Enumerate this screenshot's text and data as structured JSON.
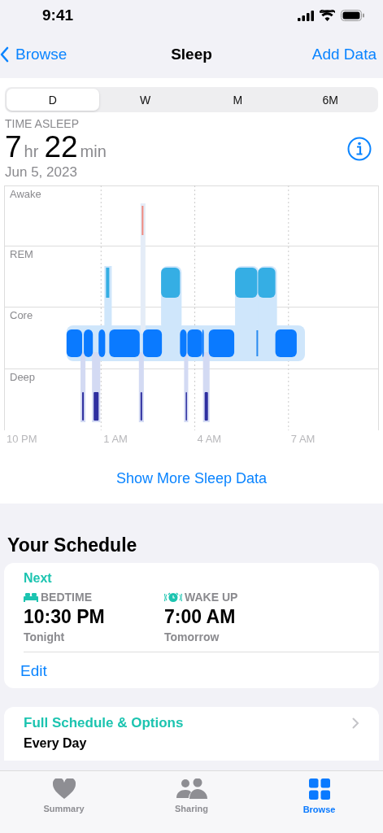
{
  "status_bar": {
    "time": "9:41"
  },
  "nav": {
    "back": "Browse",
    "title": "Sleep",
    "action": "Add Data"
  },
  "segments": [
    {
      "label": "D",
      "selected": true
    },
    {
      "label": "W",
      "selected": false
    },
    {
      "label": "M",
      "selected": false
    },
    {
      "label": "6M",
      "selected": false
    }
  ],
  "summary": {
    "label": "TIME ASLEEP",
    "hours": "7",
    "hours_unit": "hr",
    "minutes": "22",
    "minutes_unit": "min",
    "date": "Jun 5, 2023"
  },
  "chart": {
    "stages": [
      "Awake",
      "REM",
      "Core",
      "Deep"
    ],
    "times": [
      "10 PM",
      "1 AM",
      "4 AM",
      "7 AM"
    ]
  },
  "more_link": "Show More Sleep Data",
  "schedule": {
    "heading": "Your Schedule",
    "next": "Next",
    "items": [
      {
        "kind": "bedtime",
        "label": "BEDTIME",
        "time": "10:30 PM",
        "day": "Tonight"
      },
      {
        "kind": "wake",
        "label": "WAKE UP",
        "time": "7:00 AM",
        "day": "Tomorrow"
      }
    ],
    "edit": "Edit",
    "options_title": "Full Schedule & Options",
    "options_sub": "Every Day"
  },
  "tabs": [
    {
      "kind": "summary",
      "label": "Summary",
      "selected": false
    },
    {
      "kind": "sharing",
      "label": "Sharing",
      "selected": false
    },
    {
      "kind": "browse",
      "label": "Browse",
      "selected": true
    }
  ]
}
